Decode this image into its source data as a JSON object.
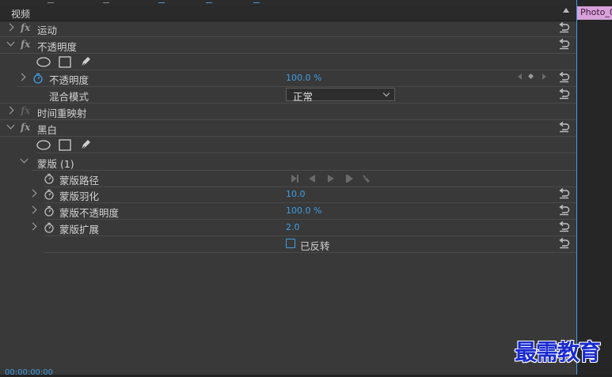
{
  "panel": {
    "title": "视频"
  },
  "rows": {
    "motion": {
      "label": "运动"
    },
    "opacity": {
      "label": "不透明度"
    },
    "opacity_prop": {
      "label": "不透明度",
      "value": "100.0 %"
    },
    "blend": {
      "label": "混合模式",
      "value": "正常"
    },
    "time_remap": {
      "label": "时间重映射"
    },
    "bw": {
      "label": "黑白"
    },
    "mask": {
      "label": "蒙版 (1)"
    },
    "mask_path": {
      "label": "蒙版路径"
    },
    "mask_feather": {
      "label": "蒙版羽化",
      "value": "10.0"
    },
    "mask_opacity": {
      "label": "蒙版不透明度",
      "value": "100.0 %"
    },
    "mask_expansion": {
      "label": "蒙版扩展",
      "value": "2.0"
    },
    "inverted": {
      "label": "已反转",
      "checked": false
    }
  },
  "fx_symbol": "fx",
  "timeline": {
    "clip_name": "Photo_0",
    "timecode": "00:00:00:00"
  },
  "watermark": "最需教育",
  "colors": {
    "accent": "#3f9ee6",
    "clip": "#d9a1d9",
    "watermark": "#1a2bd0"
  }
}
